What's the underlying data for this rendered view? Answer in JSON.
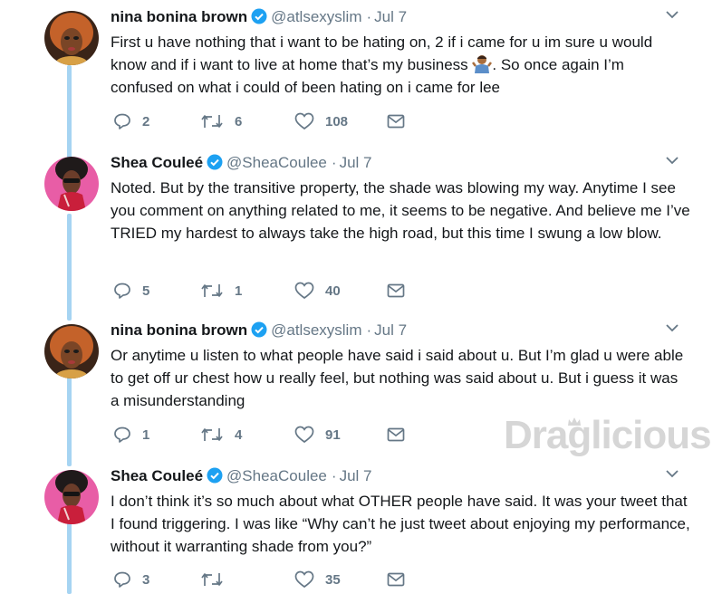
{
  "tweets": [
    {
      "name": "nina bonina brown",
      "handle": "@atlsexyslim",
      "date": "Jul 7",
      "text_before_emoji": "First u have nothing that i want to be hating on, 2 if i came for u im sure u would know and if i want to live at home that’s my business ",
      "emoji": "person-shrugging-emoji",
      "text_after_emoji": ". So once again I’m confused on what i could of been hating on i came for lee",
      "replies": "2",
      "retweets": "6",
      "likes": "108"
    },
    {
      "name": "Shea Couleé",
      "handle": "@SheaCoulee",
      "date": "Jul 7",
      "text": "Noted. But by the transitive property, the shade was blowing my way. Anytime I see you comment on anything related to me, it seems to be negative. And believe me I’ve TRIED my hardest to always take the high road, but this time I swung a low blow.",
      "replies": "5",
      "retweets": "1",
      "likes": "40"
    },
    {
      "name": "nina bonina brown",
      "handle": "@atlsexyslim",
      "date": "Jul 7",
      "text": "Or anytime u listen to what people have said i said about u. But I’m glad u were able to get off ur chest how u really feel, but nothing was said about u. But i guess it was a misunderstanding",
      "replies": "1",
      "retweets": "4",
      "likes": "91"
    },
    {
      "name": "Shea Couleé",
      "handle": "@SheaCoulee",
      "date": "Jul 7",
      "text": "I don’t think it’s so much about what OTHER people have said. It was your tweet that I found triggering. I was like “Why can’t he just tweet about enjoying my performance, without it warranting shade from you?”",
      "replies": "3",
      "retweets": "",
      "likes": "35"
    }
  ],
  "dot_separator": "·",
  "watermark": "Draglicious",
  "colors": {
    "thread_line": "#a6d4f2",
    "verified": "#1da1f2",
    "muted": "#657786",
    "text": "#14171a"
  }
}
